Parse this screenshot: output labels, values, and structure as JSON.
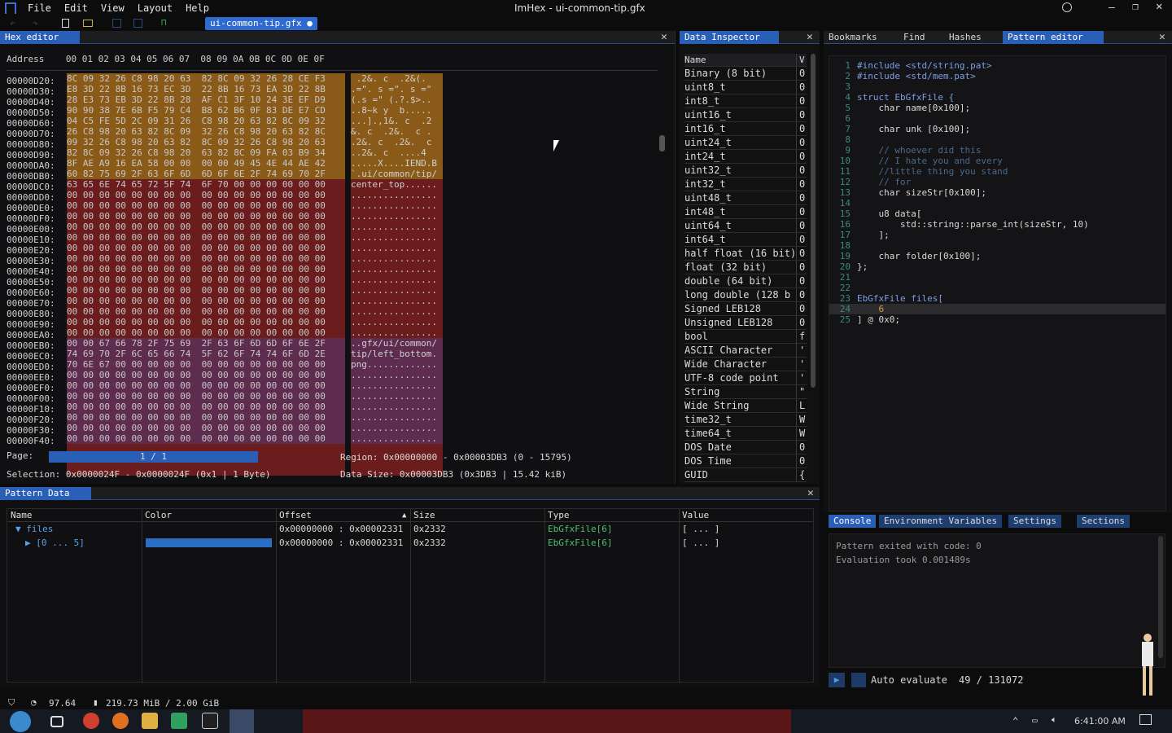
{
  "window": {
    "title": "ImHex - ui-common-tip.gfx"
  },
  "menu": [
    "File",
    "Edit",
    "View",
    "Layout",
    "Help"
  ],
  "file_tab": "ui-common-tip.gfx ●",
  "hex_editor": {
    "tab_label": "Hex editor",
    "header": "Address    00 01 02 03 04 05 06 07  08 09 0A 0B 0C 0D 0E 0F",
    "addresses": [
      "00000D20:",
      "00000D30:",
      "00000D40:",
      "00000D50:",
      "00000D60:",
      "00000D70:",
      "00000D80:",
      "00000D90:",
      "00000DA0:",
      "00000DB0:",
      "00000DC0:",
      "00000DD0:",
      "00000DE0:",
      "00000DF0:",
      "00000E00:",
      "00000E10:",
      "00000E20:",
      "00000E30:",
      "00000E40:",
      "00000E50:",
      "00000E60:",
      "00000E70:",
      "00000E80:",
      "00000E90:",
      "00000EA0:",
      "00000EB0:",
      "00000EC0:",
      "00000ED0:",
      "00000EE0:",
      "00000EF0:",
      "00000F00:",
      "00000F10:",
      "00000F20:",
      "00000F30:",
      "00000F40:"
    ],
    "bytes": [
      "8C 09 32 26 C8 98 20 63  82 8C 09 32 26 28 CE F3",
      "E8 3D 22 8B 16 73 EC 3D  22 8B 16 73 EA 3D 22 8B",
      "28 E3 73 EB 3D 22 8B 28  AF C1 3F 10 24 3E EF D9",
      "90 90 38 7E 6B F5 79 C4  B8 62 B6 0F 83 DE E7 CD",
      "04 C5 FE 5D 2C 09 31 26  C8 98 20 63 82 8C 09 32",
      "26 C8 98 20 63 82 8C 09  32 26 C8 98 20 63 82 8C",
      "09 32 26 C8 98 20 63 82  8C 09 32 26 C8 98 20 63",
      "82 8C 09 32 26 C8 98 20  63 82 8C 09 FA 03 B9 34",
      "8F AE A9 16 EA 58 00 00  00 00 49 45 4E 44 AE 42",
      "60 82 75 69 2F 63 6F 6D  6D 6F 6E 2F 74 69 70 2F",
      "63 65 6E 74 65 72 5F 74  6F 70 00 00 00 00 00 00",
      "00 00 00 00 00 00 00 00  00 00 00 00 00 00 00 00",
      "00 00 00 00 00 00 00 00  00 00 00 00 00 00 00 00",
      "00 00 00 00 00 00 00 00  00 00 00 00 00 00 00 00",
      "00 00 00 00 00 00 00 00  00 00 00 00 00 00 00 00",
      "00 00 00 00 00 00 00 00  00 00 00 00 00 00 00 00",
      "00 00 00 00 00 00 00 00  00 00 00 00 00 00 00 00",
      "00 00 00 00 00 00 00 00  00 00 00 00 00 00 00 00",
      "00 00 00 00 00 00 00 00  00 00 00 00 00 00 00 00",
      "00 00 00 00 00 00 00 00  00 00 00 00 00 00 00 00",
      "00 00 00 00 00 00 00 00  00 00 00 00 00 00 00 00",
      "00 00 00 00 00 00 00 00  00 00 00 00 00 00 00 00",
      "00 00 00 00 00 00 00 00  00 00 00 00 00 00 00 00",
      "00 00 00 00 00 00 00 00  00 00 00 00 00 00 00 00",
      "00 00 00 00 00 00 00 00  00 00 00 00 00 00 00 00",
      "00 00 67 66 78 2F 75 69  2F 63 6F 6D 6D 6F 6E 2F",
      "74 69 70 2F 6C 65 66 74  5F 62 6F 74 74 6F 6D 2E",
      "70 6E 67 00 00 00 00 00  00 00 00 00 00 00 00 00",
      "00 00 00 00 00 00 00 00  00 00 00 00 00 00 00 00",
      "00 00 00 00 00 00 00 00  00 00 00 00 00 00 00 00",
      "00 00 00 00 00 00 00 00  00 00 00 00 00 00 00 00",
      "00 00 00 00 00 00 00 00  00 00 00 00 00 00 00 00",
      "00 00 00 00 00 00 00 00  00 00 00 00 00 00 00 00",
      "00 00 00 00 00 00 00 00  00 00 00 00 00 00 00 00",
      "00 00 00 00 00 00 00 00  00 00 00 00 00 00 00 00"
    ],
    "ascii": [
      " .2&. c  .2&(.",
      ".=\". s =\". s =\"",
      "(.s =\" (.?.$>..",
      "..8~k y  b.....",
      "...].,1&. c  .2",
      "&. c  .2&.  c .",
      ".2&. c  .2&.  c",
      "..2&. c  ....4",
      ".....X....IEND.B",
      "`.ui/common/tip/",
      "center_top......",
      "................",
      "................",
      "................",
      "................",
      "................",
      "................",
      "................",
      "................",
      "................",
      "................",
      "................",
      "................",
      "................",
      "................",
      "..gfx/ui/common/",
      "tip/left_bottom.",
      "png.............",
      "................",
      "................",
      "................",
      "................",
      "................",
      "................",
      "................"
    ],
    "page_label": "Page:",
    "page_value": "1 / 1",
    "region": "Region: 0x00000000 - 0x00003DB3 (0 - 15795)",
    "selection": "Selection: 0x0000024F - 0x0000024F (0x1 | 1 Byte)",
    "data_size": "Data Size: 0x00003DB3 (0x3DB3 | 15.42 kiB)"
  },
  "inspector": {
    "tab_label": "Data Inspector",
    "col_name": "Name",
    "col_value": "V",
    "rows": [
      {
        "name": "Binary (8 bit)",
        "v": "0"
      },
      {
        "name": "uint8_t",
        "v": "0"
      },
      {
        "name": "int8_t",
        "v": "0"
      },
      {
        "name": "uint16_t",
        "v": "0"
      },
      {
        "name": "int16_t",
        "v": "0"
      },
      {
        "name": "uint24_t",
        "v": "0"
      },
      {
        "name": "int24_t",
        "v": "0"
      },
      {
        "name": "uint32_t",
        "v": "0"
      },
      {
        "name": "int32_t",
        "v": "0"
      },
      {
        "name": "uint48_t",
        "v": "0"
      },
      {
        "name": "int48_t",
        "v": "0"
      },
      {
        "name": "uint64_t",
        "v": "0"
      },
      {
        "name": "int64_t",
        "v": "0"
      },
      {
        "name": "half float (16 bit)",
        "v": "0"
      },
      {
        "name": "float (32 bit)",
        "v": "0"
      },
      {
        "name": "double (64 bit)",
        "v": "0"
      },
      {
        "name": "long double (128 b",
        "v": "0"
      },
      {
        "name": "Signed LEB128",
        "v": "0"
      },
      {
        "name": "Unsigned LEB128",
        "v": "0"
      },
      {
        "name": "bool",
        "v": "f"
      },
      {
        "name": "ASCII Character",
        "v": "'"
      },
      {
        "name": "Wide Character",
        "v": "'"
      },
      {
        "name": "UTF-8 code point",
        "v": "'"
      },
      {
        "name": "String",
        "v": "\""
      },
      {
        "name": "Wide String",
        "v": "L"
      },
      {
        "name": "time32_t",
        "v": "W"
      },
      {
        "name": "time64_t",
        "v": "W"
      },
      {
        "name": "DOS Date",
        "v": "0"
      },
      {
        "name": "DOS Time",
        "v": "0"
      },
      {
        "name": "GUID",
        "v": "{"
      }
    ]
  },
  "right_tabs": [
    "Bookmarks",
    "Find",
    "Hashes",
    "Pattern editor"
  ],
  "code_lines": [
    "#include <std/string.pat>",
    "#include <std/mem.pat>",
    "",
    "struct EbGfxFile {",
    "    char name[0x100];",
    "",
    "    char unk [0x100];",
    "",
    "    // whoever did this",
    "    // I hate you and every",
    "    //little thing you stand",
    "    // for",
    "    char sizeStr[0x100];",
    "",
    "    u8 data[",
    "        std::string::parse_int(sizeStr, 10)",
    "    ];",
    "",
    "    char folder[0x100];",
    "};",
    "",
    "",
    "EbGfxFile files[",
    "    6",
    "] @ 0x0;"
  ],
  "console_tabs": [
    "Console",
    "Environment Variables",
    "Settings",
    "Sections"
  ],
  "console_lines": [
    "Pattern exited with code: 0",
    "Evaluation took 0.001489s"
  ],
  "auto_evaluate": "Auto evaluate",
  "cursor_pos": "49 / 131072",
  "pattern_data": {
    "tab_label": "Pattern Data",
    "columns": [
      "Name",
      "Color",
      "Offset",
      "Size",
      "Type",
      "Value"
    ],
    "rows": [
      {
        "name": "▼ files",
        "offset": "0x00000000 : 0x00002331",
        "size": "0x2332",
        "type": "EbGfxFile[6]",
        "value": "[ ... ]"
      },
      {
        "name": "▶ [0 ... 5]",
        "offset": "0x00000000 : 0x00002331",
        "size": "0x2332",
        "type": "EbGfxFile[6]",
        "value": "[ ... ]"
      }
    ],
    "row_color": "#2a6fc4"
  },
  "status": {
    "fps": "97.64",
    "memory": "219.73 MiB / 2.00 GiB"
  },
  "taskbar": {
    "clock": "6:41:00 AM"
  }
}
